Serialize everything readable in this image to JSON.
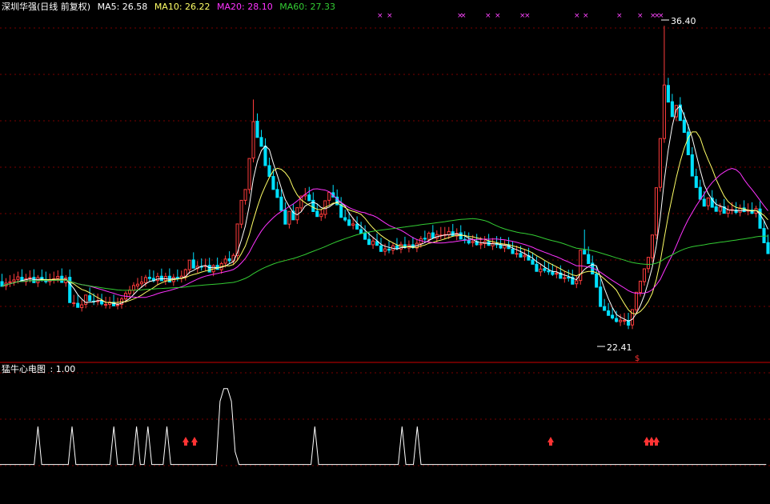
{
  "main_header": {
    "stock": "深圳华强(日线 前复权)",
    "ma5": "MA5: 26.58",
    "ma10": "MA10: 26.22",
    "ma20": "MA20: 28.10",
    "ma60": "MA60: 27.33"
  },
  "sub_header": {
    "title": "猛牛心电图",
    "value": ": 1.00"
  },
  "colors": {
    "up": "#ff3c3c",
    "down": "#00e0ff",
    "ma5": "#ffffff",
    "ma10": "#ffff66",
    "ma20": "#ff33ff",
    "ma60": "#33cc33",
    "grid": "#7a0000",
    "separator": "#cc0000",
    "marker": "#ff44ff",
    "arrow": "#ff3333"
  },
  "chart_data": {
    "type": "candlestick",
    "price_high_label": "36.40",
    "price_low_label": "22.41",
    "ma_legend": [
      "MA5",
      "MA10",
      "MA20",
      "MA60"
    ],
    "candles_key": [
      "open",
      "high",
      "low",
      "close"
    ],
    "candles": [
      [
        24.6,
        24.96,
        24.41,
        24.38
      ],
      [
        24.4,
        24.76,
        24.21,
        24.53
      ],
      [
        24.55,
        24.9,
        24.35,
        24.59
      ],
      [
        24.6,
        24.96,
        24.41,
        24.68
      ],
      [
        24.7,
        25.06,
        24.51,
        24.82
      ],
      [
        24.8,
        25.17,
        24.62,
        24.62
      ],
      [
        24.6,
        24.96,
        24.41,
        24.73
      ],
      [
        24.75,
        25.12,
        24.56,
        24.79
      ],
      [
        24.8,
        25.17,
        24.62,
        24.55
      ],
      [
        24.55,
        24.9,
        24.35,
        24.79
      ],
      [
        24.8,
        25.16,
        24.6,
        24.71
      ],
      [
        24.7,
        25.06,
        24.51,
        24.59
      ],
      [
        24.6,
        24.97,
        24.42,
        24.69
      ],
      [
        24.7,
        25.06,
        24.51,
        24.73
      ],
      [
        24.75,
        25.12,
        24.56,
        24.84
      ],
      [
        24.85,
        25.21,
        24.65,
        24.56
      ],
      [
        24.55,
        24.9,
        24.36,
        24.77
      ],
      [
        24.8,
        25.16,
        24.6,
        23.63
      ],
      [
        23.6,
        23.99,
        23.44,
        23.62
      ],
      [
        23.6,
        23.98,
        23.42,
        23.41
      ],
      [
        23.4,
        23.75,
        23.22,
        23.53
      ],
      [
        23.55,
        23.9,
        23.37,
        23.98
      ],
      [
        23.95,
        24.33,
        23.76,
        23.71
      ],
      [
        23.7,
        24.06,
        23.52,
        23.68
      ],
      [
        23.7,
        24.05,
        23.51,
        23.71
      ],
      [
        23.7,
        24.04,
        23.5,
        23.57
      ],
      [
        23.55,
        23.9,
        23.36,
        23.55
      ],
      [
        23.55,
        23.9,
        23.35,
        23.65
      ],
      [
        23.65,
        24.0,
        23.46,
        23.48
      ],
      [
        23.5,
        23.86,
        23.32,
        23.53
      ],
      [
        23.55,
        23.89,
        23.35,
        23.8
      ],
      [
        23.8,
        24.16,
        23.62,
        24.06
      ],
      [
        24.05,
        24.4,
        23.85,
        24.21
      ],
      [
        24.2,
        24.57,
        24.01,
        24.42
      ],
      [
        24.4,
        24.77,
        24.21,
        24.48
      ],
      [
        24.5,
        24.86,
        24.31,
        24.58
      ],
      [
        24.55,
        24.91,
        24.36,
        24.79
      ],
      [
        24.8,
        25.16,
        24.61,
        24.74
      ],
      [
        24.75,
        25.11,
        24.56,
        24.64
      ],
      [
        24.65,
        25.01,
        24.45,
        24.84
      ],
      [
        24.85,
        25.2,
        24.65,
        24.64
      ],
      [
        24.65,
        25.01,
        24.45,
        24.84
      ],
      [
        24.85,
        25.21,
        24.65,
        24.58
      ],
      [
        24.6,
        24.95,
        24.4,
        24.8
      ],
      [
        24.8,
        25.16,
        24.61,
        24.76
      ],
      [
        24.75,
        25.11,
        24.56,
        24.85
      ],
      [
        24.85,
        25.2,
        24.65,
        25.15
      ],
      [
        25.15,
        25.52,
        24.96,
        25.59
      ],
      [
        25.6,
        25.95,
        25.4,
        25.22
      ],
      [
        25.2,
        25.55,
        25.01,
        25.31
      ],
      [
        25.3,
        25.67,
        25.11,
        25.28
      ],
      [
        25.3,
        25.66,
        25.1,
        25.33
      ],
      [
        25.35,
        25.7,
        25.15,
        25.04
      ],
      [
        25.05,
        25.4,
        24.85,
        25.34
      ],
      [
        25.35,
        25.71,
        25.15,
        25.16
      ],
      [
        25.15,
        25.52,
        24.96,
        25.43
      ],
      [
        25.45,
        25.8,
        25.25,
        25.64
      ],
      [
        25.65,
        26.0,
        25.45,
        25.56
      ],
      [
        25.55,
        25.91,
        25.36,
        25.81
      ],
      [
        25.8,
        26.16,
        25.61,
        27.26
      ],
      [
        27.25,
        27.62,
        27.06,
        28.35
      ],
      [
        28.35,
        28.71,
        28.15,
        28.85
      ],
      [
        28.85,
        29.21,
        28.65,
        30.28
      ],
      [
        30.3,
        33.0,
        30.1,
        31.98
      ],
      [
        32.0,
        32.36,
        31.8,
        31.25
      ],
      [
        31.25,
        31.6,
        31.05,
        30.84
      ],
      [
        30.85,
        31.21,
        30.65,
        29.95
      ],
      [
        29.95,
        30.32,
        29.76,
        29.45
      ],
      [
        29.45,
        29.82,
        29.26,
        28.85
      ],
      [
        28.85,
        29.21,
        28.66,
        28.48
      ],
      [
        28.5,
        28.86,
        28.3,
        27.88
      ],
      [
        27.9,
        28.26,
        27.7,
        27.25
      ],
      [
        27.25,
        27.6,
        27.05,
        27.84
      ],
      [
        27.85,
        28.2,
        27.65,
        27.45
      ],
      [
        27.45,
        27.81,
        27.26,
        28.01
      ],
      [
        28.0,
        28.36,
        27.81,
        28.55
      ],
      [
        28.55,
        28.92,
        28.36,
        28.61
      ],
      [
        28.6,
        28.97,
        28.41,
        28.33
      ],
      [
        28.35,
        28.72,
        28.16,
        27.83
      ],
      [
        27.85,
        28.2,
        27.65,
        27.6
      ],
      [
        27.6,
        27.95,
        27.4,
        27.71
      ],
      [
        27.7,
        28.06,
        27.51,
        28.33
      ],
      [
        28.35,
        28.7,
        28.15,
        28.72
      ],
      [
        28.7,
        29.06,
        28.51,
        28.5
      ],
      [
        28.5,
        28.85,
        28.3,
        28.14
      ],
      [
        28.15,
        28.5,
        27.95,
        27.56
      ],
      [
        27.55,
        27.92,
        27.36,
        27.44
      ],
      [
        27.45,
        27.81,
        27.26,
        27.19
      ],
      [
        27.2,
        27.56,
        27.01,
        27.26
      ],
      [
        27.25,
        27.61,
        27.06,
        27.02
      ],
      [
        27.0,
        27.36,
        26.82,
        26.83
      ],
      [
        26.85,
        27.2,
        26.65,
        26.55
      ],
      [
        26.55,
        26.91,
        26.35,
        26.31
      ],
      [
        26.3,
        26.66,
        26.11,
        26.47
      ],
      [
        26.45,
        26.82,
        26.26,
        26.27
      ],
      [
        26.25,
        26.62,
        26.05,
        25.99
      ],
      [
        26.0,
        26.35,
        25.8,
        26.11
      ],
      [
        26.1,
        26.46,
        25.91,
        26.05
      ],
      [
        26.05,
        26.41,
        25.85,
        26.25
      ],
      [
        26.25,
        26.61,
        26.05,
        26.11
      ],
      [
        26.1,
        26.45,
        25.91,
        26.32
      ],
      [
        26.3,
        26.67,
        26.11,
        26.17
      ],
      [
        26.15,
        26.5,
        25.95,
        26.3
      ],
      [
        26.3,
        26.66,
        26.11,
        26.17
      ],
      [
        26.15,
        26.52,
        25.96,
        26.37
      ],
      [
        26.35,
        26.7,
        26.16,
        26.58
      ],
      [
        26.6,
        26.95,
        26.4,
        26.56
      ],
      [
        26.55,
        26.91,
        26.36,
        26.83
      ],
      [
        26.85,
        27.21,
        26.65,
        26.62
      ],
      [
        26.6,
        26.96,
        26.41,
        26.77
      ],
      [
        26.75,
        27.12,
        26.55,
        26.75
      ],
      [
        26.75,
        27.12,
        26.56,
        26.77
      ],
      [
        26.75,
        27.12,
        26.56,
        26.91
      ],
      [
        26.9,
        27.26,
        26.71,
        26.72
      ],
      [
        26.7,
        27.06,
        26.51,
        26.83
      ],
      [
        26.85,
        27.2,
        26.65,
        26.56
      ],
      [
        26.55,
        26.92,
        26.36,
        26.52
      ],
      [
        26.5,
        26.87,
        26.31,
        26.38
      ],
      [
        26.4,
        26.75,
        26.2,
        26.45
      ],
      [
        26.45,
        26.8,
        26.26,
        26.3
      ],
      [
        26.3,
        26.66,
        26.1,
        26.34
      ],
      [
        26.35,
        26.7,
        26.15,
        26.45
      ],
      [
        26.45,
        26.8,
        26.25,
        26.27
      ],
      [
        26.25,
        26.61,
        26.06,
        26.37
      ],
      [
        26.35,
        26.7,
        26.15,
        26.3
      ],
      [
        26.3,
        26.66,
        26.1,
        26.15
      ],
      [
        26.15,
        26.51,
        25.96,
        26.28
      ],
      [
        26.3,
        26.65,
        26.1,
        26.12
      ],
      [
        26.1,
        26.46,
        25.91,
        25.89
      ],
      [
        25.9,
        26.26,
        25.71,
        25.9
      ],
      [
        25.9,
        26.25,
        25.71,
        25.73
      ],
      [
        25.75,
        26.1,
        25.56,
        25.81
      ],
      [
        25.8,
        26.16,
        25.61,
        25.59
      ],
      [
        25.6,
        25.95,
        25.4,
        25.4
      ],
      [
        25.4,
        25.76,
        25.2,
        25.07
      ],
      [
        25.05,
        25.42,
        24.85,
        25.18
      ],
      [
        25.2,
        25.55,
        25.01,
        25.11
      ],
      [
        25.1,
        25.46,
        24.91,
        25.05
      ],
      [
        25.05,
        25.42,
        24.86,
        24.93
      ],
      [
        24.95,
        25.3,
        24.75,
        24.98
      ],
      [
        25.0,
        25.35,
        24.81,
        24.75
      ],
      [
        24.75,
        25.1,
        24.55,
        24.78
      ],
      [
        24.8,
        25.15,
        24.6,
        24.78
      ],
      [
        24.8,
        25.15,
        24.61,
        24.48
      ],
      [
        24.5,
        24.86,
        24.3,
        24.64
      ],
      [
        24.65,
        25.0,
        24.46,
        26.05
      ],
      [
        26.05,
        27.0,
        25.85,
        25.87
      ],
      [
        25.85,
        26.22,
        25.66,
        25.43
      ],
      [
        25.45,
        25.8,
        25.25,
        24.95
      ],
      [
        24.95,
        25.31,
        24.76,
        24.34
      ],
      [
        24.35,
        24.71,
        24.16,
        23.45
      ],
      [
        23.45,
        23.8,
        23.25,
        23.27
      ],
      [
        23.25,
        23.61,
        23.06,
        23.04
      ],
      [
        23.05,
        23.4,
        22.85,
        22.92
      ],
      [
        22.9,
        23.25,
        22.71,
        22.76
      ],
      [
        22.75,
        23.1,
        22.55,
        22.82
      ],
      [
        22.8,
        23.15,
        22.61,
        22.81
      ],
      [
        22.8,
        23.16,
        22.41,
        22.59
      ],
      [
        22.6,
        22.96,
        22.41,
        23.31
      ],
      [
        23.3,
        23.66,
        23.11,
        24.11
      ],
      [
        24.1,
        24.46,
        23.91,
        24.62
      ],
      [
        24.6,
        24.96,
        24.41,
        25.19
      ],
      [
        25.2,
        25.57,
        25.01,
        25.72
      ],
      [
        25.7,
        26.05,
        25.5,
        26.75
      ],
      [
        26.75,
        27.1,
        26.55,
        28.93
      ],
      [
        28.95,
        29.31,
        28.75,
        31.2
      ],
      [
        31.2,
        36.4,
        31.0,
        33.67
      ],
      [
        33.65,
        34.0,
        33.46,
        32.88
      ],
      [
        32.9,
        33.26,
        32.71,
        32.21
      ],
      [
        32.2,
        32.55,
        32.0,
        32.73
      ],
      [
        32.75,
        33.11,
        32.55,
        32.03
      ],
      [
        32.05,
        32.41,
        31.86,
        31.48
      ],
      [
        31.5,
        31.86,
        31.3,
        30.45
      ],
      [
        30.45,
        30.8,
        30.25,
        29.47
      ],
      [
        29.45,
        29.81,
        29.26,
        28.94
      ],
      [
        28.95,
        29.3,
        28.75,
        28.4
      ],
      [
        28.4,
        28.77,
        28.21,
        28.08
      ],
      [
        28.1,
        28.45,
        27.9,
        28.46
      ],
      [
        28.45,
        28.82,
        28.25,
        28.03
      ],
      [
        28.05,
        28.41,
        27.86,
        27.84
      ],
      [
        27.85,
        28.21,
        27.66,
        28.04
      ],
      [
        28.05,
        28.41,
        27.86,
        27.75
      ],
      [
        27.75,
        28.12,
        27.56,
        27.91
      ],
      [
        27.9,
        28.26,
        27.7,
        27.92
      ],
      [
        27.9,
        28.27,
        27.71,
        27.79
      ],
      [
        27.8,
        28.16,
        27.61,
        27.99
      ],
      [
        28.0,
        28.35,
        27.8,
        27.83
      ],
      [
        27.85,
        28.21,
        27.66,
        27.9
      ],
      [
        27.9,
        28.26,
        27.71,
        27.75
      ],
      [
        27.75,
        28.1,
        27.56,
        27.97
      ],
      [
        27.95,
        28.31,
        27.75,
        27.06
      ],
      [
        27.05,
        27.42,
        26.86,
        26.39
      ],
      [
        26.4,
        26.77,
        26.21,
        25.89
      ]
    ],
    "ecg_values": [
      0.3,
      0.3,
      0.3,
      0.3,
      0.3,
      0.3,
      0.3,
      0.3,
      0.3,
      0.3,
      0.6,
      0.3,
      0.3,
      0.3,
      0.3,
      0.3,
      0.3,
      0.3,
      0.3,
      0.6,
      0.3,
      0.3,
      0.3,
      0.3,
      0.3,
      0.3,
      0.3,
      0.3,
      0.3,
      0.3,
      0.6,
      0.3,
      0.3,
      0.3,
      0.3,
      0.3,
      0.6,
      0.3,
      0.3,
      0.6,
      0.3,
      0.3,
      0.3,
      0.3,
      0.6,
      0.3,
      0.3,
      0.3,
      0.3,
      0.3,
      0.3,
      0.3,
      0.3,
      0.3,
      0.3,
      0.3,
      0.3,
      0.3,
      0.8,
      0.9,
      0.9,
      0.8,
      0.4,
      0.3,
      0.3,
      0.3,
      0.3,
      0.3,
      0.3,
      0.3,
      0.3,
      0.3,
      0.3,
      0.3,
      0.3,
      0.3,
      0.3,
      0.3,
      0.3,
      0.3,
      0.3,
      0.3,
      0.3,
      0.6,
      0.3,
      0.3,
      0.3,
      0.3,
      0.3,
      0.3,
      0.3,
      0.3,
      0.3,
      0.3,
      0.3,
      0.3,
      0.3,
      0.3,
      0.3,
      0.3,
      0.3,
      0.3,
      0.3,
      0.3,
      0.3,
      0.3,
      0.6,
      0.3,
      0.3,
      0.3,
      0.6,
      0.3,
      0.3,
      0.3,
      0.3,
      0.3,
      0.3,
      0.3,
      0.3,
      0.3,
      0.3,
      0.3,
      0.3,
      0.3,
      0.3,
      0.3,
      0.3,
      0.3,
      0.3,
      0.3,
      0.3,
      0.3,
      0.3,
      0.3,
      0.3,
      0.3,
      0.3,
      0.3,
      0.3,
      0.3,
      0.3,
      0.3,
      0.3,
      0.3,
      0.3,
      0.3,
      0.3,
      0.3,
      0.3,
      0.3,
      0.3,
      0.3,
      0.3,
      0.3,
      0.3,
      0.3,
      0.3,
      0.3,
      0.3,
      0.3,
      0.3,
      0.3,
      0.3,
      0.3,
      0.3,
      0.3,
      0.3,
      0.3,
      0.3,
      0.3,
      0.3,
      0.3,
      0.3,
      0.3,
      0.3,
      0.3,
      0.3,
      0.3,
      0.3,
      0.3,
      0.3,
      0.3,
      0.3,
      0.3,
      0.3,
      0.3,
      0.3,
      0.3,
      0.3,
      0.3,
      0.3,
      0.3,
      0.3,
      0.3,
      0.3,
      0.3,
      0.3,
      0.3,
      0.3,
      0.3,
      0.3,
      0.3,
      0.3
    ]
  }
}
